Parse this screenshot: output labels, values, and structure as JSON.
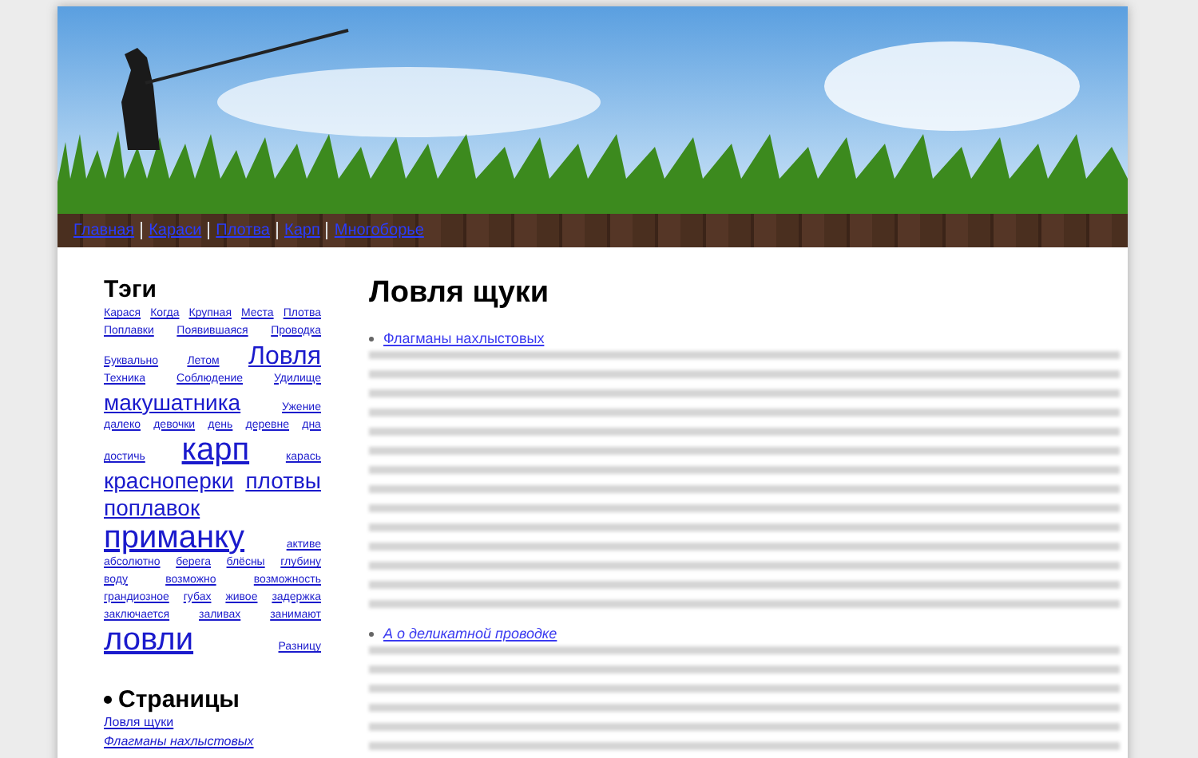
{
  "nav": [
    "Главная",
    "Караси",
    "Плотва",
    "Карп",
    "Многоборье"
  ],
  "tags_title": "Тэги",
  "tags": [
    {
      "label": "Карася",
      "kind": "small"
    },
    {
      "label": "Когда",
      "kind": "small"
    },
    {
      "label": "Крупная",
      "kind": "small"
    },
    {
      "label": "Места",
      "kind": "small"
    },
    {
      "label": "Плотва",
      "kind": "small"
    },
    {
      "label": "Поплавки",
      "kind": "small"
    },
    {
      "label": "Появившаяся",
      "kind": "small"
    },
    {
      "label": "Проводка",
      "kind": "small"
    },
    {
      "label": "Буквально",
      "kind": "small"
    },
    {
      "label": "Летом",
      "kind": "small"
    },
    {
      "label": "Ловля",
      "kind": "large"
    },
    {
      "label": "Техника",
      "kind": "small"
    },
    {
      "label": "Соблюдение",
      "kind": "small"
    },
    {
      "label": "Удилище",
      "kind": "small"
    },
    {
      "label": "макушатника",
      "kind": "medium"
    },
    {
      "label": "Ужение",
      "kind": "small"
    },
    {
      "label": "далеко",
      "kind": "small"
    },
    {
      "label": "девочки",
      "kind": "small"
    },
    {
      "label": "день",
      "kind": "small"
    },
    {
      "label": "деревне",
      "kind": "small"
    },
    {
      "label": "дна",
      "kind": "small"
    },
    {
      "label": "достичь",
      "kind": "small"
    },
    {
      "label": "карп",
      "kind": "huge"
    },
    {
      "label": "карась",
      "kind": "small"
    },
    {
      "label": "красноперки",
      "kind": "medium"
    },
    {
      "label": "плотвы",
      "kind": "medium"
    },
    {
      "label": "поплавок",
      "kind": "medium"
    },
    {
      "label": "приманку",
      "kind": "huge"
    },
    {
      "label": "активе",
      "kind": "small"
    },
    {
      "label": "абсолютно",
      "kind": "small"
    },
    {
      "label": "берега",
      "kind": "small"
    },
    {
      "label": "блёсны",
      "kind": "small"
    },
    {
      "label": "глубину",
      "kind": "small"
    },
    {
      "label": "воду",
      "kind": "small"
    },
    {
      "label": "возможно",
      "kind": "small"
    },
    {
      "label": "возможность",
      "kind": "small"
    },
    {
      "label": "грандиозное",
      "kind": "small"
    },
    {
      "label": "губах",
      "kind": "small"
    },
    {
      "label": "живое",
      "kind": "small"
    },
    {
      "label": "задержка",
      "kind": "small"
    },
    {
      "label": "заключается",
      "kind": "small"
    },
    {
      "label": "заливах",
      "kind": "small"
    },
    {
      "label": "занимают",
      "kind": "small"
    },
    {
      "label": "ловли",
      "kind": "huge"
    },
    {
      "label": "Разницу",
      "kind": "small"
    }
  ],
  "pages_title": "Страницы",
  "pages": [
    "Ловля щуки",
    "Флагманы нахлыстовых"
  ],
  "article": {
    "title": "Ловля щуки",
    "entries": [
      {
        "link": "Флагманы нахлыстовых"
      },
      {
        "link": "А о деликатной проводке"
      }
    ]
  }
}
